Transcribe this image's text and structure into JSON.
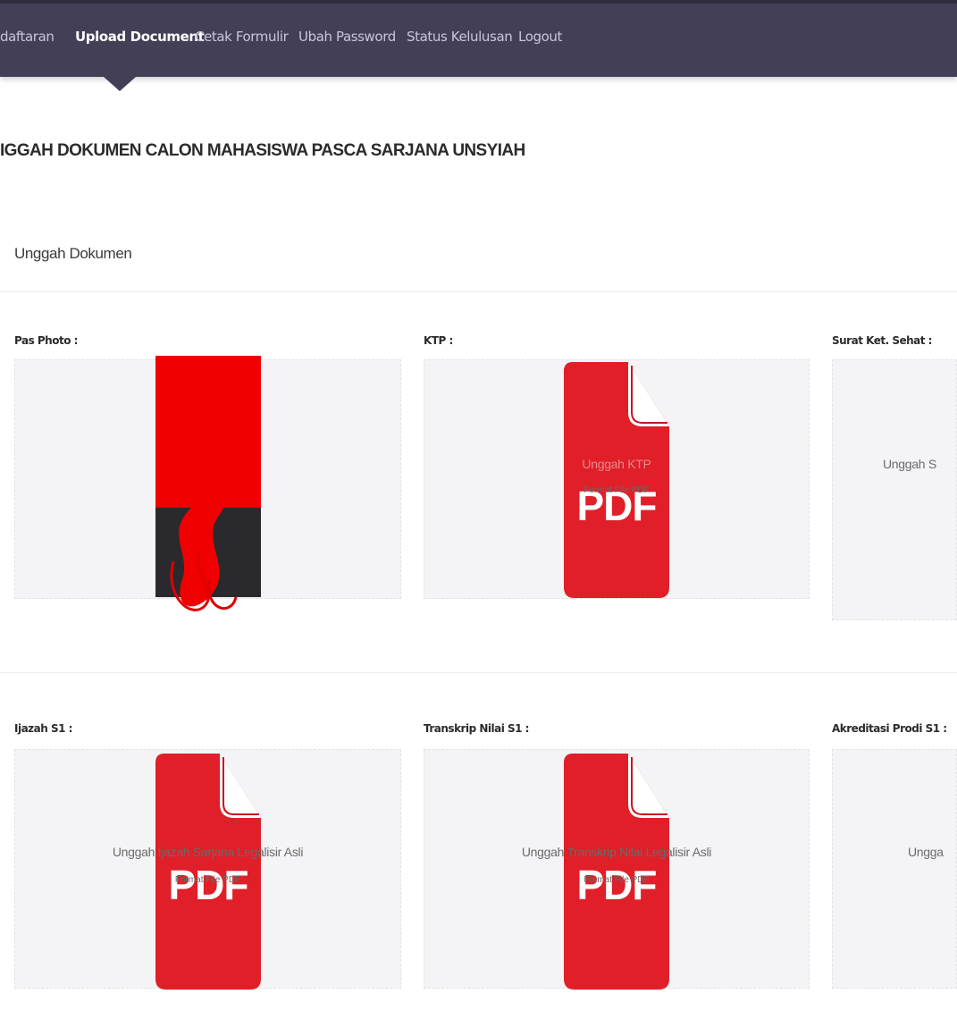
{
  "nav": {
    "items": [
      {
        "label": "daftaran"
      },
      {
        "label": "Upload Document"
      },
      {
        "label": "Cetak Formulir"
      },
      {
        "label": "Ubah Password"
      },
      {
        "label": "Status Kelulusan"
      },
      {
        "label": "Logout"
      }
    ],
    "active_index": 1
  },
  "page": {
    "title": "IGGAH DOKUMEN CALON MAHASISWA PASCA SARJANA UNSYIAH"
  },
  "card": {
    "title": "Unggah Dokumen"
  },
  "fields": [
    {
      "label": "Pas Photo :",
      "drop_text": "",
      "drop_sub": "",
      "icon": "photo-thumbnail"
    },
    {
      "label": "KTP :",
      "drop_text": "Unggah KTP",
      "drop_sub": "Format File PDF",
      "icon": "pdf-file-icon"
    },
    {
      "label": "Surat Ket. Sehat :",
      "drop_text": "Unggah S",
      "drop_sub": "",
      "icon": ""
    },
    {
      "label": "Ijazah S1 :",
      "drop_text": "Unggah Ijazah Sarjana Legalisir Asli",
      "drop_sub": "Format File PDF",
      "icon": "pdf-file-icon"
    },
    {
      "label": "Transkrip Nilai S1 :",
      "drop_text": "Unggah Transkrip Nilai Legalisir Asli",
      "drop_sub": "Format File PDF",
      "icon": "pdf-file-icon"
    },
    {
      "label": "Akreditasi Prodi S1 :",
      "drop_text": "Unggа",
      "drop_sub": "",
      "icon": ""
    }
  ],
  "pdf_icon": {
    "text": "PDF"
  },
  "colors": {
    "navbar": "#433f57",
    "pdf_red": "#e01f28",
    "dropzone": "#f4f4f7"
  }
}
